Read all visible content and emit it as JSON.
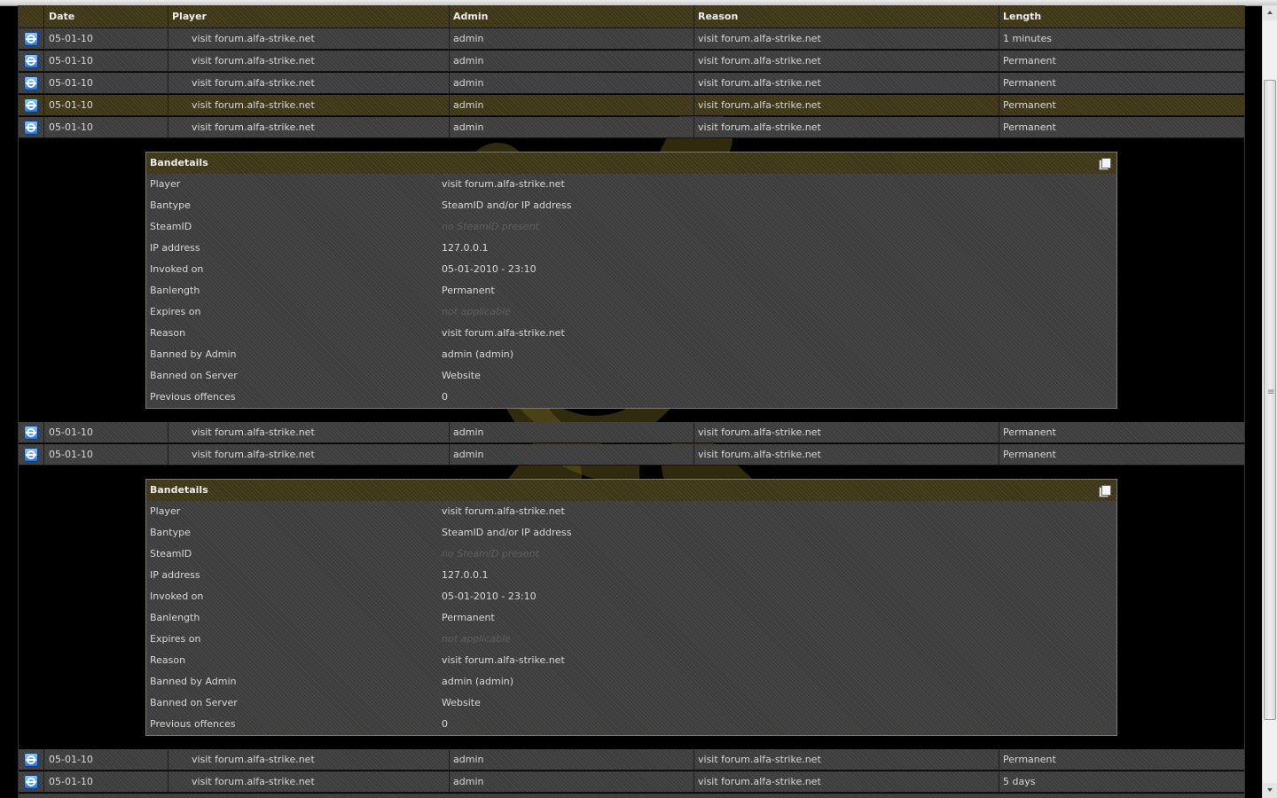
{
  "table": {
    "headers": [
      "Date",
      "Player",
      "Admin",
      "Reason",
      "Length"
    ],
    "rows_top": [
      {
        "date": "05-01-10",
        "player": "visit forum.alfa-strike.net",
        "admin": "admin",
        "reason": "visit forum.alfa-strike.net",
        "length": "1 minutes"
      },
      {
        "date": "05-01-10",
        "player": "visit forum.alfa-strike.net",
        "admin": "admin",
        "reason": "visit forum.alfa-strike.net",
        "length": "Permanent"
      },
      {
        "date": "05-01-10",
        "player": "visit forum.alfa-strike.net",
        "admin": "admin",
        "reason": "visit forum.alfa-strike.net",
        "length": "Permanent"
      },
      {
        "date": "05-01-10",
        "player": "visit forum.alfa-strike.net",
        "admin": "admin",
        "reason": "visit forum.alfa-strike.net",
        "length": "Permanent"
      },
      {
        "date": "05-01-10",
        "player": "visit forum.alfa-strike.net",
        "admin": "admin",
        "reason": "visit forum.alfa-strike.net",
        "length": "Permanent"
      }
    ],
    "rows_middle": [
      {
        "date": "05-01-10",
        "player": "visit forum.alfa-strike.net",
        "admin": "admin",
        "reason": "visit forum.alfa-strike.net",
        "length": "Permanent"
      },
      {
        "date": "05-01-10",
        "player": "visit forum.alfa-strike.net",
        "admin": "admin",
        "reason": "visit forum.alfa-strike.net",
        "length": "Permanent"
      }
    ],
    "rows_bottom": [
      {
        "date": "05-01-10",
        "player": "visit forum.alfa-strike.net",
        "admin": "admin",
        "reason": "visit forum.alfa-strike.net",
        "length": "Permanent"
      },
      {
        "date": "05-01-10",
        "player": "visit forum.alfa-strike.net",
        "admin": "admin",
        "reason": "visit forum.alfa-strike.net",
        "length": "5 days"
      }
    ]
  },
  "details": [
    {
      "title": "Bandetails",
      "fields": [
        {
          "label": "Player",
          "value": "visit forum.alfa-strike.net"
        },
        {
          "label": "Bantype",
          "value": "SteamID and/or IP address"
        },
        {
          "label": "SteamID",
          "value": "no SteamID present"
        },
        {
          "label": "IP address",
          "value": "127.0.0.1"
        },
        {
          "label": "Invoked on",
          "value": "05-01-2010 - 23:10"
        },
        {
          "label": "Banlength",
          "value": "Permanent"
        },
        {
          "label": "Expires on",
          "value": "not applicable"
        },
        {
          "label": "Reason",
          "value": "visit forum.alfa-strike.net"
        },
        {
          "label": "Banned by Admin",
          "value": "admin (admin)"
        },
        {
          "label": "Banned on Server",
          "value": "Website"
        },
        {
          "label": "Previous offences",
          "value": "0"
        }
      ]
    },
    {
      "title": "Bandetails",
      "fields": [
        {
          "label": "Player",
          "value": "visit forum.alfa-strike.net"
        },
        {
          "label": "Bantype",
          "value": "SteamID and/or IP address"
        },
        {
          "label": "SteamID",
          "value": "no SteamID present"
        },
        {
          "label": "IP address",
          "value": "127.0.0.1"
        },
        {
          "label": "Invoked on",
          "value": "05-01-2010 - 23:10"
        },
        {
          "label": "Banlength",
          "value": "Permanent"
        },
        {
          "label": "Expires on",
          "value": "not applicable"
        },
        {
          "label": "Reason",
          "value": "visit forum.alfa-strike.net"
        },
        {
          "label": "Banned by Admin",
          "value": "admin (admin)"
        },
        {
          "label": "Banned on Server",
          "value": "Website"
        },
        {
          "label": "Previous offences",
          "value": "0"
        }
      ]
    }
  ],
  "icons": {
    "row_icon": "internet-explorer-icon",
    "copy_icon": "copy-icon"
  },
  "colors": {
    "accent": "#3b3418",
    "row": "#3c3c3c",
    "background": "#000000"
  }
}
